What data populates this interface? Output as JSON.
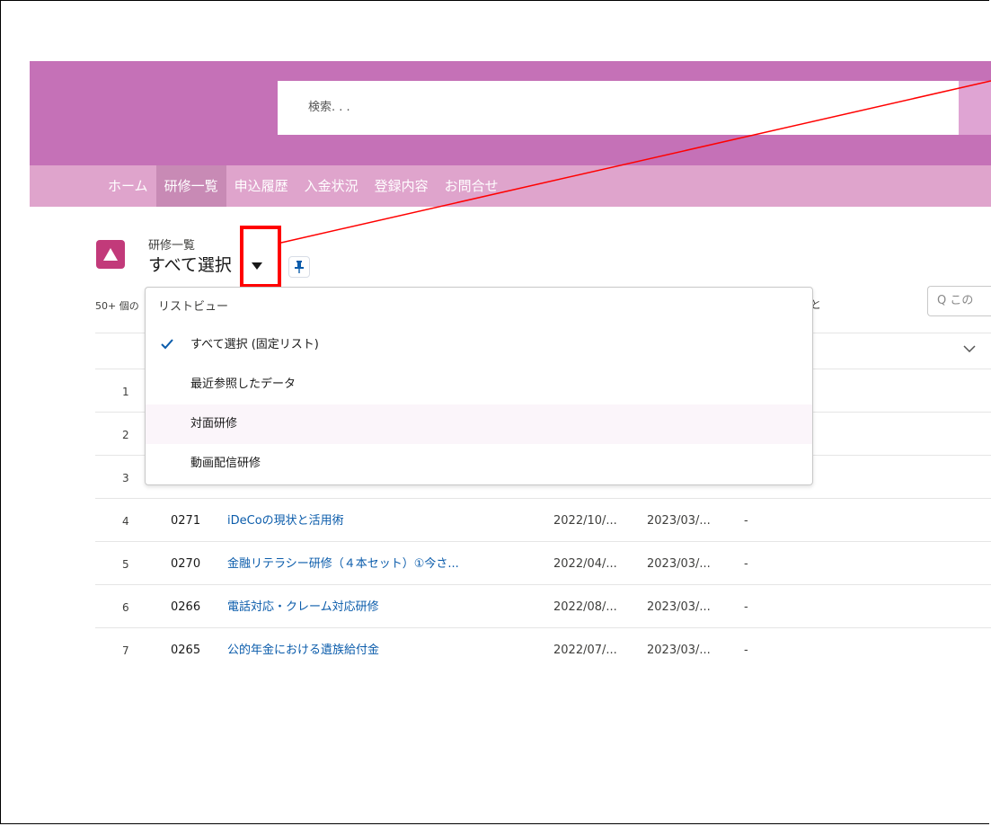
{
  "search": {
    "placeholder": "検索. . ."
  },
  "nav": {
    "items": [
      {
        "label": "ホーム"
      },
      {
        "label": "研修一覧"
      },
      {
        "label": "申込履歴"
      },
      {
        "label": "入金状況"
      },
      {
        "label": "登録内容"
      },
      {
        "label": "お問合せ"
      }
    ]
  },
  "list_header": {
    "object_label": "研修一覧",
    "view_title": "すべて選択",
    "count_text": "50+ 個の",
    "count_suffix": "と",
    "search_placeholder": "Q この"
  },
  "dropdown": {
    "header": "リストビュー",
    "items": [
      {
        "label": "すべて選択 (固定リスト)",
        "selected": true
      },
      {
        "label": "最近参照したデータ"
      },
      {
        "label": "対面研修"
      },
      {
        "label": "動画配信研修"
      }
    ]
  },
  "table": {
    "rows": [
      {
        "num": "1"
      },
      {
        "num": "2"
      },
      {
        "num": "3"
      },
      {
        "num": "4",
        "code": "0271",
        "title": "iDeCoの現状と活用術",
        "d1": "2022/10/...",
        "d2": "2023/03/...",
        "d3": "-"
      },
      {
        "num": "5",
        "code": "0270",
        "title": "金融リテラシー研修（４本セット）①今さ...",
        "d1": "2022/04/...",
        "d2": "2023/03/...",
        "d3": "-"
      },
      {
        "num": "6",
        "code": "0266",
        "title": "電話対応・クレーム対応研修",
        "d1": "2022/08/...",
        "d2": "2023/03/...",
        "d3": "-"
      },
      {
        "num": "7",
        "code": "0265",
        "title": "公的年金における遺族給付金",
        "d1": "2022/07/...",
        "d2": "2023/03/...",
        "d3": "-"
      }
    ]
  },
  "colors": {
    "header_bg": "#c571b7",
    "nav_bg": "#dfa4cc",
    "link": "#0b5cab",
    "annotation": "#ff0000"
  }
}
